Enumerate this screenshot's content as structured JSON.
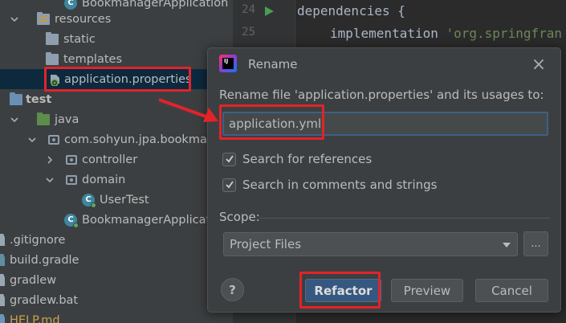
{
  "tree": {
    "rows": [
      {
        "label": "BookmanagerApplication"
      },
      {
        "label": "resources"
      },
      {
        "label": "static"
      },
      {
        "label": "templates"
      },
      {
        "label": "application.properties"
      },
      {
        "label": "test"
      },
      {
        "label": "java"
      },
      {
        "label": "com.sohyun.jpa.bookmana"
      },
      {
        "label": "controller"
      },
      {
        "label": "domain"
      },
      {
        "label": "UserTest"
      },
      {
        "label": "BookmanagerApplicatio"
      },
      {
        "label": ".gitignore"
      },
      {
        "label": "build.gradle"
      },
      {
        "label": "gradlew"
      },
      {
        "label": "gradlew.bat"
      },
      {
        "label": "HELP.md"
      }
    ]
  },
  "editor": {
    "line_numbers": [
      "24",
      "25"
    ],
    "line24": "dependencies {",
    "line25_keyword": "implementation",
    "line25_string": "'org.springfran"
  },
  "dialog": {
    "title": "Rename",
    "prompt": "Rename file 'application.properties' and its usages to:",
    "new_name": "application.yml",
    "search_references": {
      "label": "Search for references",
      "checked": true
    },
    "search_comments": {
      "label": "Search in comments and strings",
      "checked": true
    },
    "scope_label": "Scope:",
    "scope_value": "Project Files",
    "ellipsis": "...",
    "help": "?",
    "buttons": {
      "refactor": "Refactor",
      "preview": "Preview",
      "cancel": "Cancel"
    }
  },
  "colors": {
    "highlight": "#e2232a",
    "primary_button": "#365880",
    "dialog_bg": "#3c3f41",
    "editor_bg": "#2b2b2b"
  }
}
